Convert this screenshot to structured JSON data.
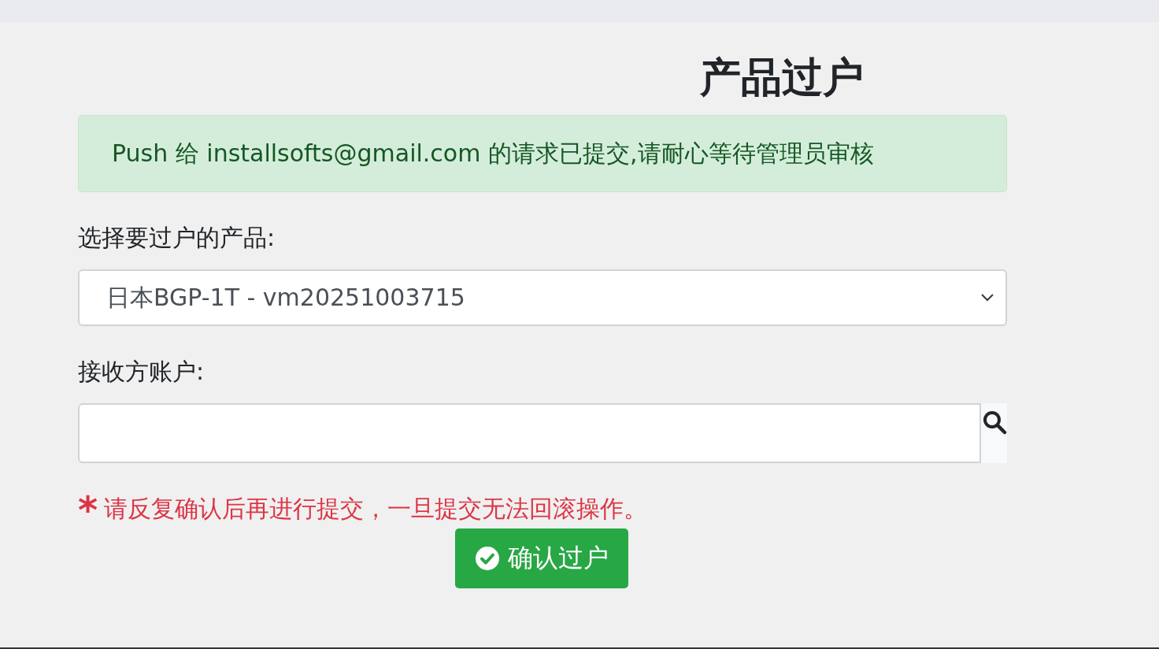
{
  "title": "产品过户",
  "alert": {
    "text": "Push 给 installsofts@gmail.com 的请求已提交,请耐心等待管理员审核"
  },
  "product": {
    "label": "选择要过户的产品:",
    "value": "日本BGP-1T - vm20251003715"
  },
  "recipient": {
    "label": "接收方账户:"
  },
  "warning": {
    "mark": "*",
    "text": "请反复确认后再进行提交，一旦提交无法回滚操作。"
  },
  "submit": {
    "label": "确认过户"
  }
}
